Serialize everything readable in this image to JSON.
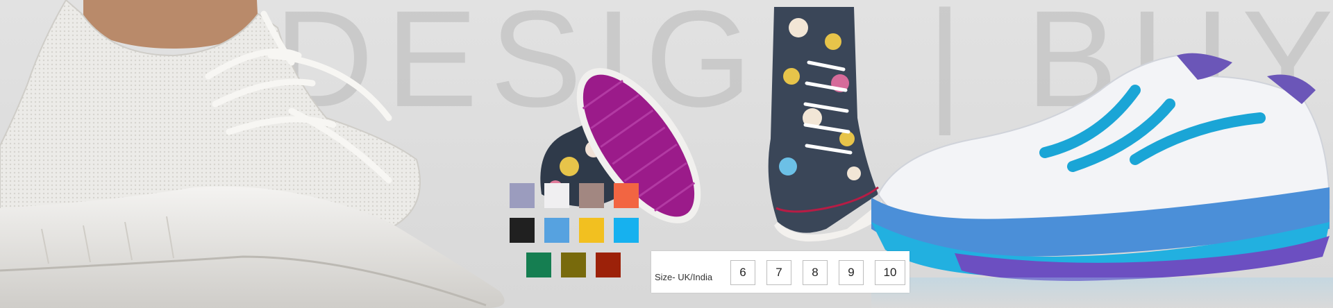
{
  "banner": {
    "headline": "DESIGN | BUY"
  },
  "color_swatches": [
    "#9b9cbe",
    "#f0eff1",
    "#a28781",
    "#f26542",
    "#202020",
    "#56a2e0",
    "#f2c020",
    "#16b1ef",
    "#157e51",
    "#786a0c",
    "#9c2109"
  ],
  "size_selector": {
    "label": "Size- UK/India",
    "sizes": [
      "6",
      "7",
      "8",
      "9",
      "10"
    ]
  },
  "icons": {
    "sneaker_white": "white-knit-sneaker-image",
    "hightop_sole": "magenta-sole-hightop-image",
    "hightop_printed": "printed-hightop-image",
    "running_shoe": "blue-running-shoe-image"
  }
}
